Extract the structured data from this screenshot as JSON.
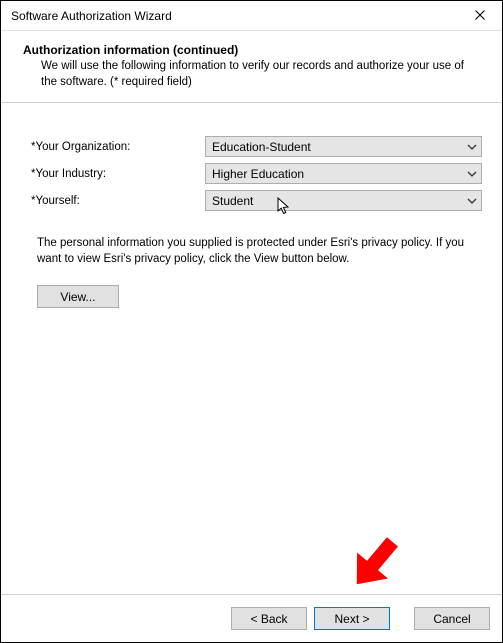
{
  "window": {
    "title": "Software Authorization Wizard"
  },
  "header": {
    "title": "Authorization information (continued)",
    "description": "We will use the following information to verify our records and authorize your use of the software. (* required field)"
  },
  "form": {
    "organization": {
      "label": "*Your Organization:",
      "value": "Education-Student"
    },
    "industry": {
      "label": "*Your Industry:",
      "value": "Higher Education"
    },
    "yourself": {
      "label": "*Yourself:",
      "value": "Student"
    }
  },
  "privacy": {
    "text": "The personal information you supplied is protected under Esri's privacy policy. If you want to view Esri's privacy policy, click the View button below.",
    "view_label": "View..."
  },
  "footer": {
    "back_label": "< Back",
    "next_label": "Next >",
    "cancel_label": "Cancel"
  }
}
